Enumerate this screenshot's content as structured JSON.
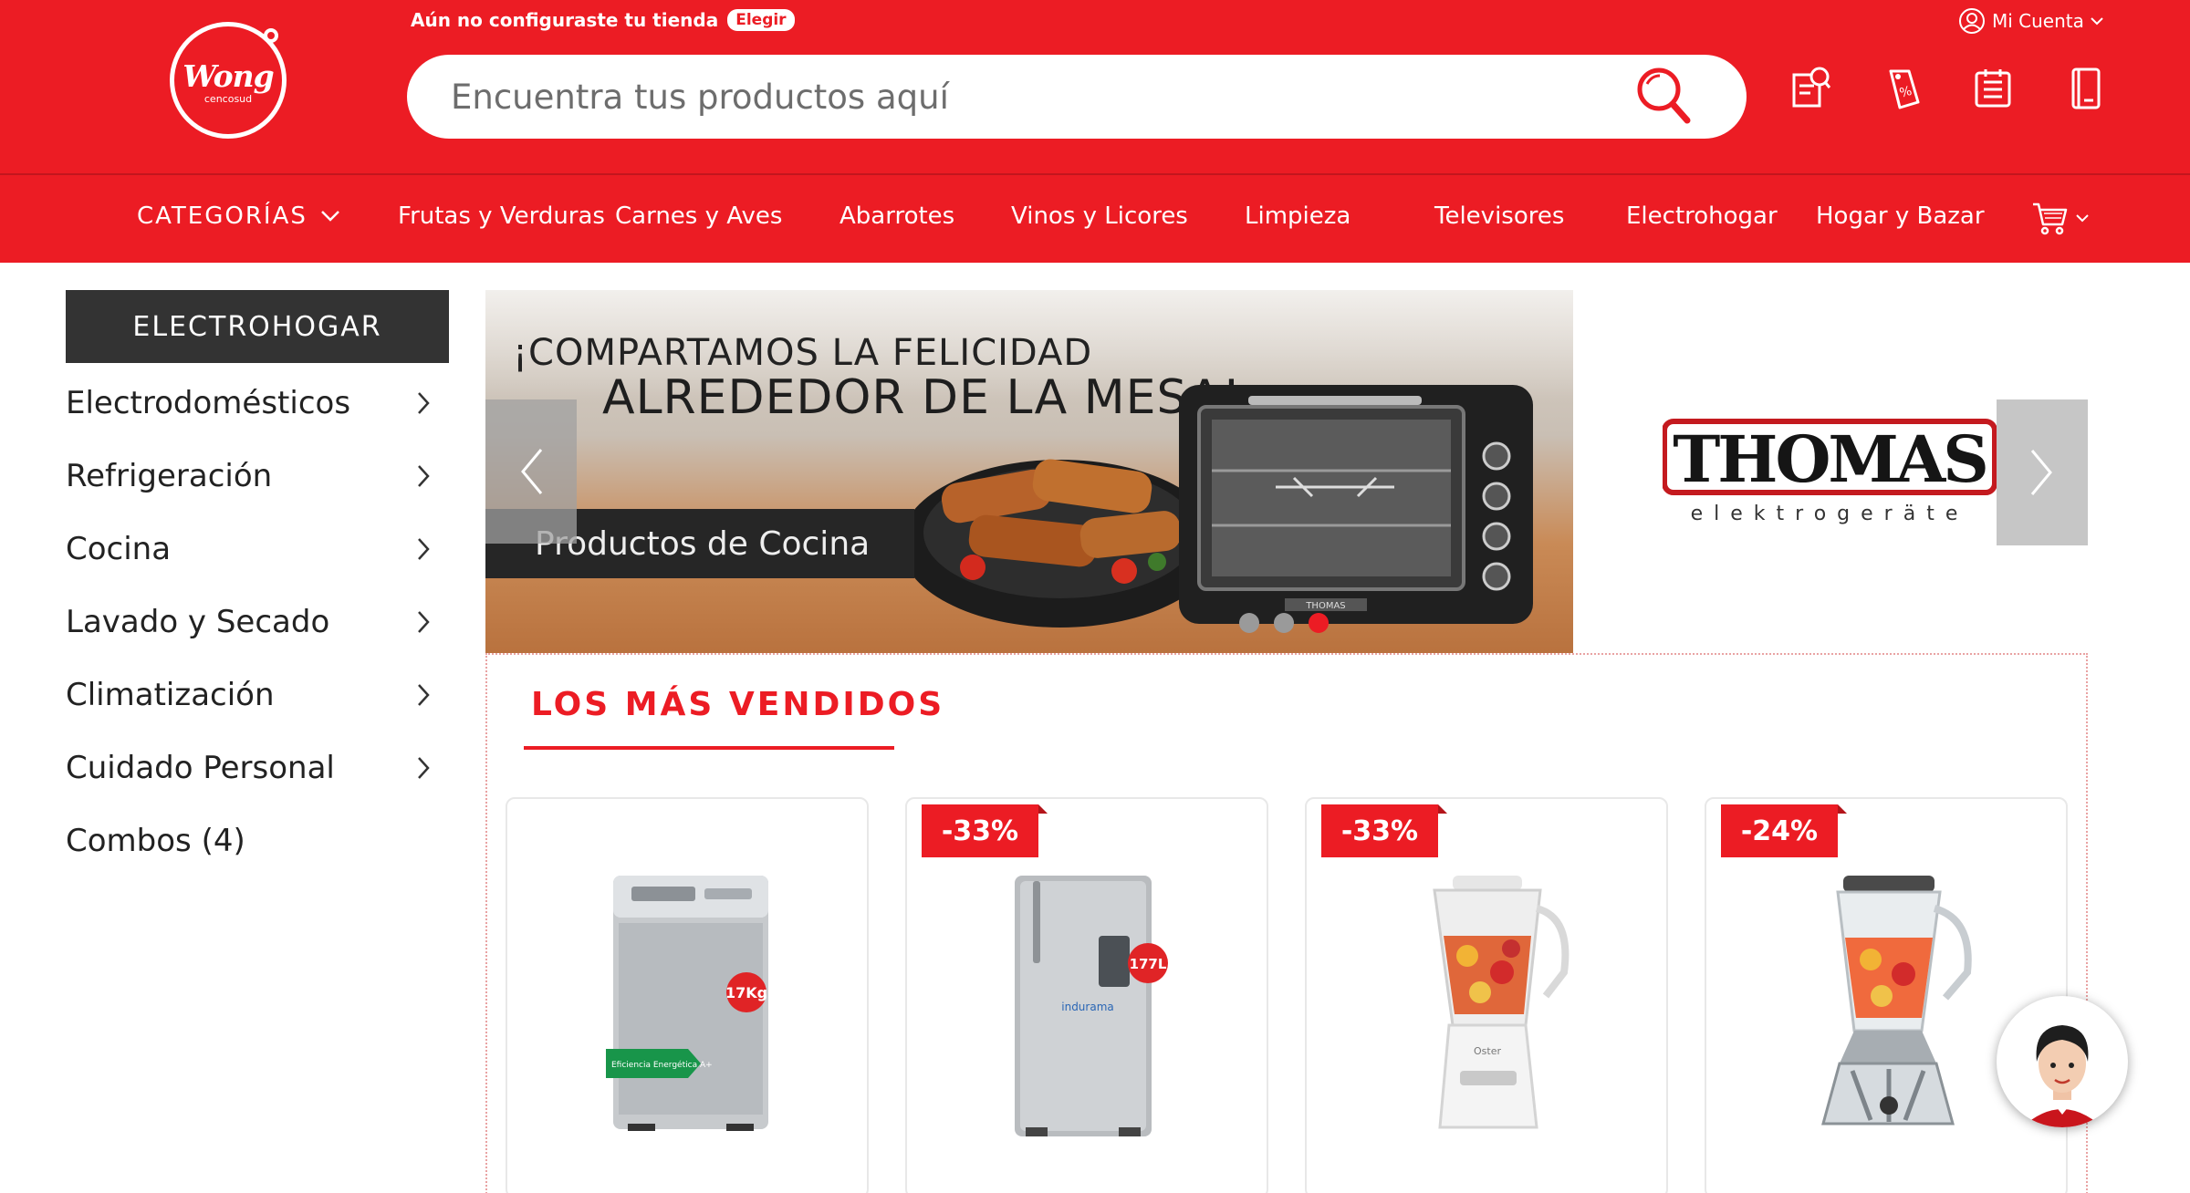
{
  "header": {
    "logo_text": "Wong",
    "logo_sub": "cencosud",
    "store_note": "Aún no configuraste tu tienda",
    "store_button": "Elegir",
    "account_label": "Mi Cuenta",
    "search_placeholder": "Encuentra tus productos aquí",
    "icons": [
      "orders-icon",
      "offers-icon",
      "list-icon",
      "catalog-icon"
    ]
  },
  "nav": {
    "categories_label": "CATEGORÍAS",
    "items": [
      "Frutas y Verduras",
      "Carnes y Aves",
      "Abarrotes",
      "Vinos y Licores",
      "Limpieza",
      "Televisores",
      "Electrohogar",
      "Hogar y Bazar"
    ]
  },
  "sidebar": {
    "title": "ELECTROHOGAR",
    "items": [
      {
        "label": "Electrodomésticos"
      },
      {
        "label": "Refrigeración"
      },
      {
        "label": "Cocina"
      },
      {
        "label": "Lavado y Secado"
      },
      {
        "label": "Climatización"
      },
      {
        "label": "Cuidado Personal"
      },
      {
        "label": "Combos (4)"
      }
    ]
  },
  "banner": {
    "line1": "¡COMPARTAMOS LA FELICIDAD",
    "line2": "ALREDEDOR DE LA MESA!",
    "tag": "Productos de Cocina",
    "oven_brand": "THOMAS",
    "slides_count": 3,
    "active_slide": 3
  },
  "brand": {
    "name": "THOMAS",
    "tagline": "elektrogeräte"
  },
  "best_sellers": {
    "title": "LOS MÁS VENDIDOS",
    "products": [
      {
        "badge": "",
        "image": "washing-machine",
        "capacity": "17Kg",
        "label": "Eficiencia Energética A+"
      },
      {
        "badge": "-33%",
        "image": "refrigerator",
        "capacity": "177L",
        "brand": "indurama"
      },
      {
        "badge": "-33%",
        "image": "blender-white",
        "brand": "Oster"
      },
      {
        "badge": "-24%",
        "image": "blender-chrome"
      }
    ]
  },
  "colors": {
    "brand_red": "#ec1c24",
    "dark": "#333333"
  }
}
